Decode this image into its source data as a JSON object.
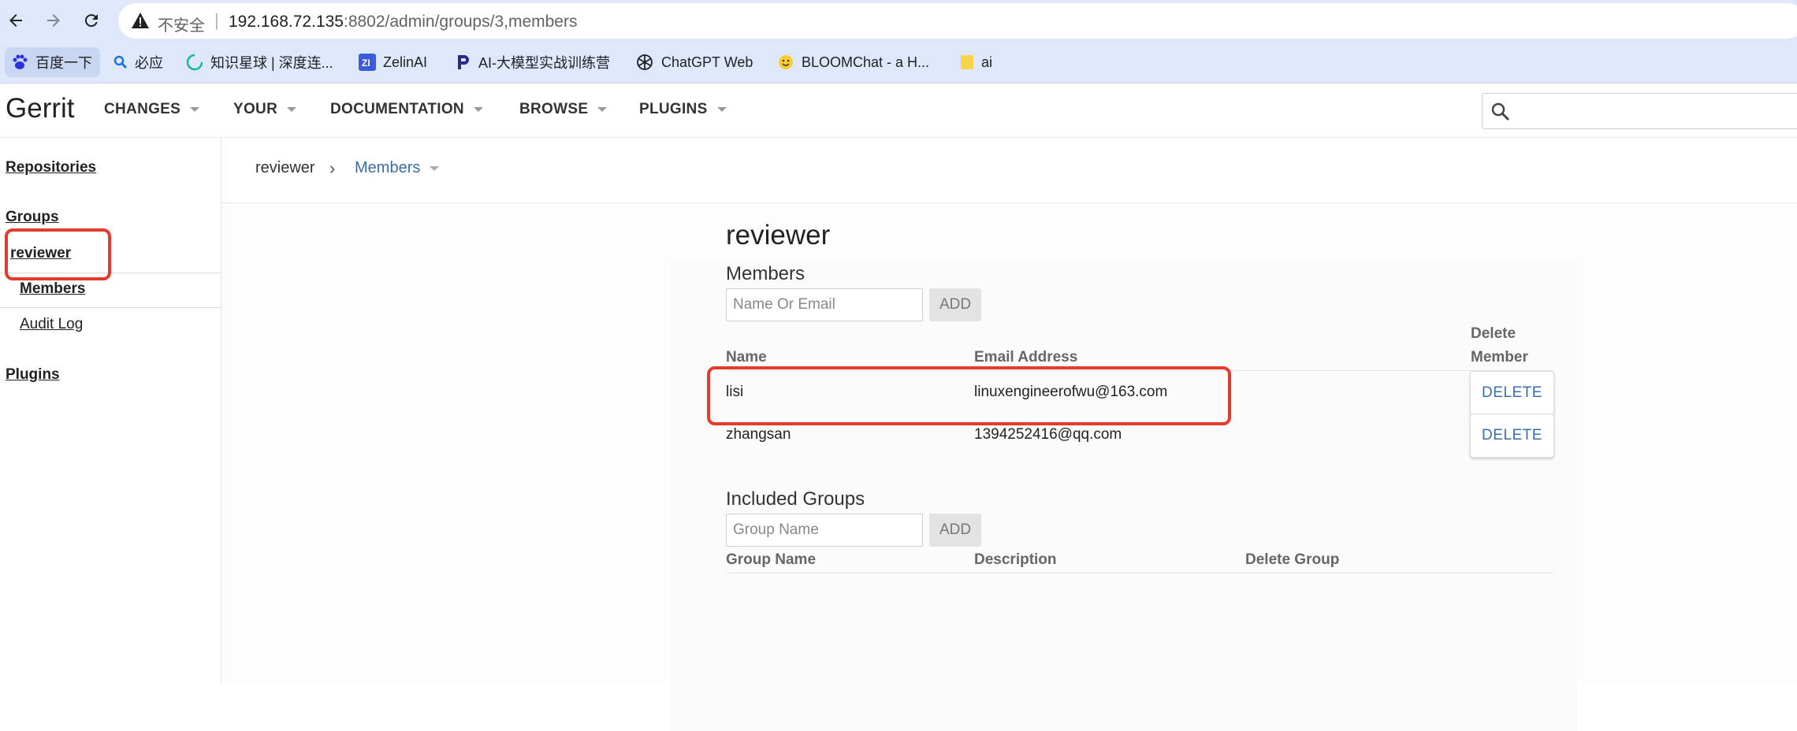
{
  "browser": {
    "url_insecure": "不安全",
    "url_sep": "|",
    "url_host": "192.168.72.135",
    "url_path": ":8802/admin/groups/3,members",
    "bookmarks": [
      {
        "label": "百度一下",
        "icon": "baidu-paw-icon"
      },
      {
        "label": "必应",
        "icon": "bing-search-icon"
      },
      {
        "label": "知识星球 | 深度连...",
        "icon": "zsxq-ring-icon"
      },
      {
        "label": "ZelinAI",
        "icon": "zelinai-icon"
      },
      {
        "label": "AI-大模型实战训练营",
        "icon": "p-logo-icon"
      },
      {
        "label": "ChatGPT Web",
        "icon": "openai-icon"
      },
      {
        "label": "BLOOMChat - a H...",
        "icon": "hugging-face-icon"
      },
      {
        "label": "ai",
        "icon": "folder-icon"
      }
    ]
  },
  "gerrit": {
    "logo": "Gerrit",
    "menu": [
      "CHANGES",
      "YOUR",
      "DOCUMENTATION",
      "BROWSE",
      "PLUGINS"
    ]
  },
  "sidebar": {
    "repositories": "Repositories",
    "groups": "Groups",
    "group_name": "reviewer",
    "members": "Members",
    "audit_log": "Audit Log",
    "plugins": "Plugins"
  },
  "breadcrumb": {
    "group": "reviewer",
    "separator": "›",
    "page": "Members"
  },
  "main": {
    "title": "reviewer",
    "members_heading": "Members",
    "members_input_placeholder": "Name Or Email",
    "add_label": "ADD",
    "columns": {
      "name": "Name",
      "email": "Email Address",
      "delete_line1": "Delete",
      "delete_line2": "Member"
    },
    "members": [
      {
        "name": "lisi",
        "email": "linuxengineerofwu@163.com",
        "action": "DELETE"
      },
      {
        "name": "zhangsan",
        "email": "1394252416@qq.com",
        "action": "DELETE"
      }
    ],
    "included_heading": "Included Groups",
    "group_input_placeholder": "Group Name",
    "group_columns": {
      "group_name": "Group Name",
      "description": "Description",
      "delete_group": "Delete Group"
    }
  },
  "colors": {
    "accent_link": "#3b6ea8",
    "highlight_red": "#e53b2c",
    "chrome_blue": "#dfe8fb"
  }
}
